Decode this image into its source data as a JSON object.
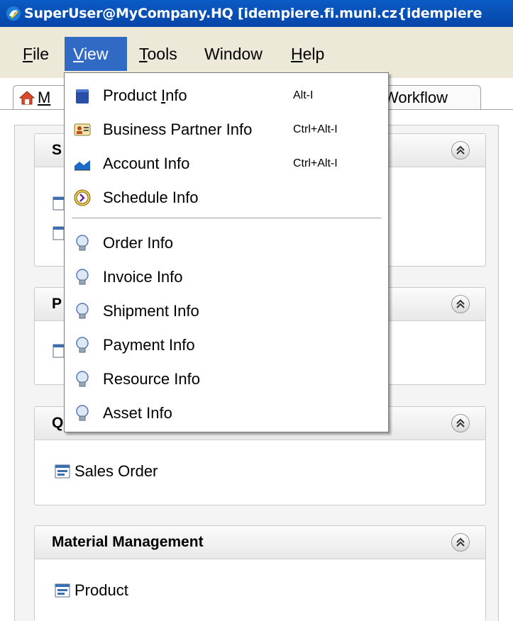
{
  "window": {
    "title": "SuperUser@MyCompany.HQ [idempiere.fi.muni.cz{idempiere"
  },
  "menubar": [
    {
      "pre": "",
      "mn": "F",
      "post": "ile",
      "active": false
    },
    {
      "pre": "",
      "mn": "V",
      "post": "iew",
      "active": true
    },
    {
      "pre": "",
      "mn": "T",
      "post": "ools",
      "active": false
    },
    {
      "pre": "Window",
      "mn": "",
      "post": "",
      "active": false
    },
    {
      "pre": "",
      "mn": "H",
      "post": "elp",
      "active": false
    }
  ],
  "tabs": {
    "home_fragment": "M",
    "workflow": "Workflow"
  },
  "view_menu": {
    "items": [
      {
        "pre": "Product ",
        "mn": "I",
        "post": "nfo",
        "accel": "Alt-I",
        "icon": "product-info-icon"
      },
      {
        "pre": "Business Partner Info",
        "mn": "",
        "post": "",
        "accel": "Ctrl+Alt-I",
        "icon": "business-partner-icon"
      },
      {
        "pre": "Account Info",
        "mn": "",
        "post": "",
        "accel": "Ctrl+Alt-I",
        "icon": "account-chart-icon"
      },
      {
        "pre": "Schedule Info",
        "mn": "",
        "post": "",
        "accel": "",
        "icon": "schedule-clock-icon"
      }
    ],
    "info_items": [
      {
        "label": "Order Info",
        "icon": "lightbulb-icon"
      },
      {
        "label": "Invoice Info",
        "icon": "lightbulb-icon"
      },
      {
        "label": "Shipment Info",
        "icon": "lightbulb-icon"
      },
      {
        "label": "Payment Info",
        "icon": "lightbulb-icon"
      },
      {
        "label": "Resource Info",
        "icon": "lightbulb-icon"
      },
      {
        "label": "Asset Info",
        "icon": "lightbulb-icon"
      }
    ]
  },
  "panels": [
    {
      "title": "S",
      "items": []
    },
    {
      "title": "P",
      "items": []
    },
    {
      "title": "Q",
      "items": [
        "Sales Order"
      ]
    },
    {
      "title": "Material Management",
      "items": [
        "Product"
      ]
    }
  ],
  "colors": {
    "titlebar": "#0a5bc4",
    "menu_highlight": "#316ac5"
  }
}
